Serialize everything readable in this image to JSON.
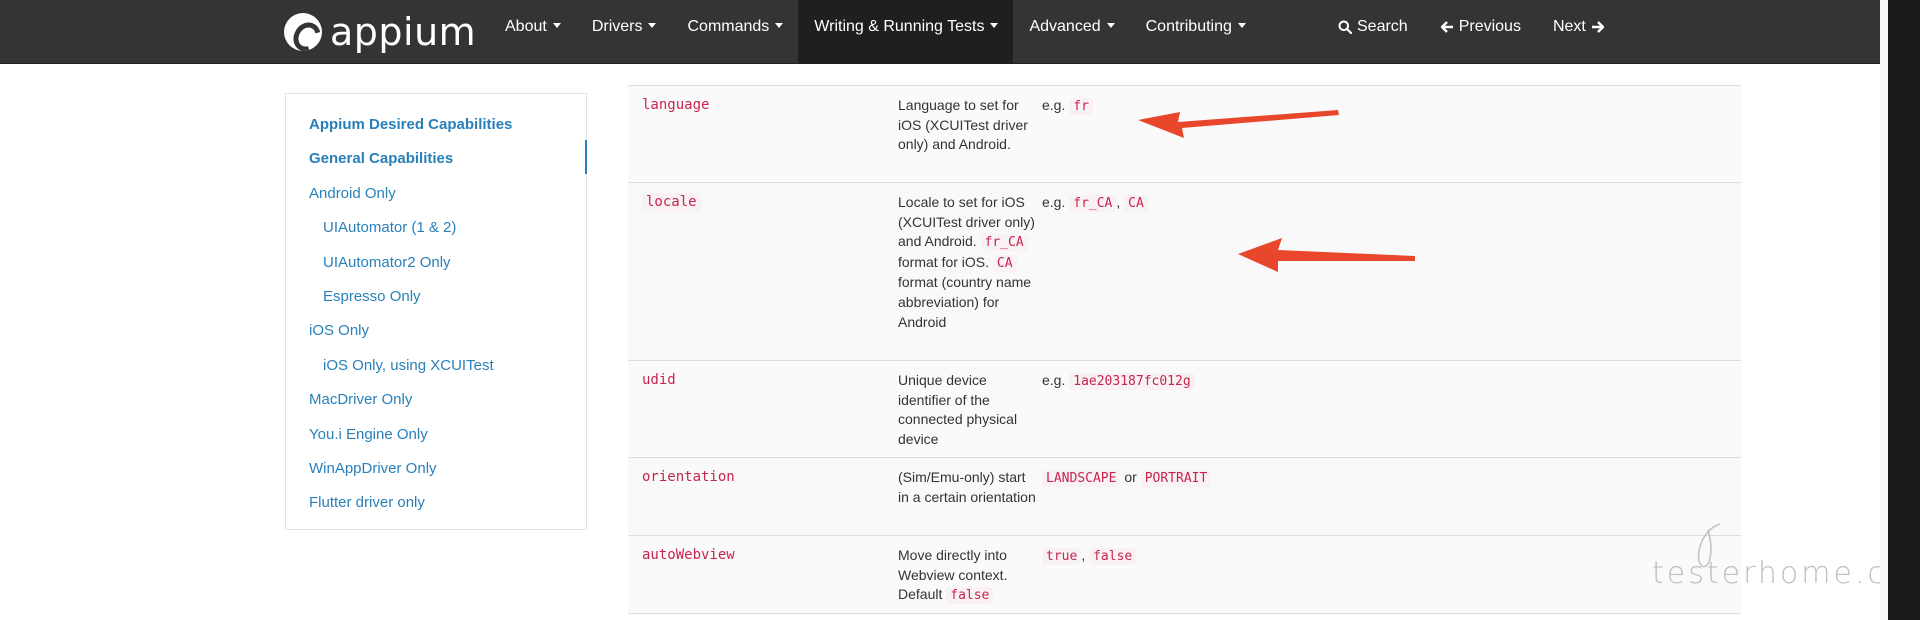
{
  "navbar": {
    "brand": "appium",
    "items": [
      {
        "label": "About",
        "active": false
      },
      {
        "label": "Drivers",
        "active": false
      },
      {
        "label": "Commands",
        "active": false
      },
      {
        "label": "Writing & Running Tests",
        "active": true
      },
      {
        "label": "Advanced",
        "active": false
      },
      {
        "label": "Contributing",
        "active": false
      }
    ],
    "search_label": "Search",
    "previous_label": "Previous",
    "next_label": "Next"
  },
  "sidebar": {
    "items": [
      {
        "label": "Appium Desired Capabilities",
        "bold": true,
        "sub": false
      },
      {
        "label": "General Capabilities",
        "bold": true,
        "sub": false
      },
      {
        "label": "Android Only",
        "bold": false,
        "sub": false
      },
      {
        "label": "UIAutomator (1 & 2)",
        "bold": false,
        "sub": true
      },
      {
        "label": "UIAutomator2 Only",
        "bold": false,
        "sub": true
      },
      {
        "label": "Espresso Only",
        "bold": false,
        "sub": true
      },
      {
        "label": "iOS Only",
        "bold": false,
        "sub": false
      },
      {
        "label": "iOS Only, using XCUITest",
        "bold": false,
        "sub": true
      },
      {
        "label": "MacDriver Only",
        "bold": false,
        "sub": false
      },
      {
        "label": "You.i Engine Only",
        "bold": false,
        "sub": false
      },
      {
        "label": "WinAppDriver Only",
        "bold": false,
        "sub": false
      },
      {
        "label": "Flutter driver only",
        "bold": false,
        "sub": false
      }
    ]
  },
  "table": {
    "rows": [
      {
        "name": "language",
        "desc": "Language to set for iOS (XCUITest driver only) and Android.",
        "eg": "e.g.",
        "vals": [
          "fr"
        ]
      },
      {
        "name": "locale",
        "desc_parts": [
          "Locale to set for iOS (XCUITest driver only) and Android. ",
          "fr_CA",
          " format for iOS. ",
          "CA",
          " format (country name abbreviation) for Android"
        ],
        "eg": "e.g.",
        "vals": [
          "fr_CA",
          "CA"
        ],
        "sep": ", "
      },
      {
        "name": "udid",
        "desc": "Unique device identifier of the connected physical device",
        "eg": "e.g.",
        "vals": [
          "1ae203187fc012g"
        ]
      },
      {
        "name": "orientation",
        "desc": "(Sim/Emu-only) start in a certain orientation",
        "vals": [
          "LANDSCAPE",
          "PORTRAIT"
        ],
        "sep": " or "
      },
      {
        "name": "autoWebview",
        "desc_parts": [
          "Move directly into Webview context. Default ",
          "false"
        ],
        "vals": [
          "true",
          "false"
        ],
        "sep": ", "
      }
    ]
  },
  "watermark": "testerhome.com",
  "colors": {
    "navbar_bg": "#343434",
    "link": "#2980b9",
    "code": "#c7254e",
    "arrow": "#e8472b"
  }
}
